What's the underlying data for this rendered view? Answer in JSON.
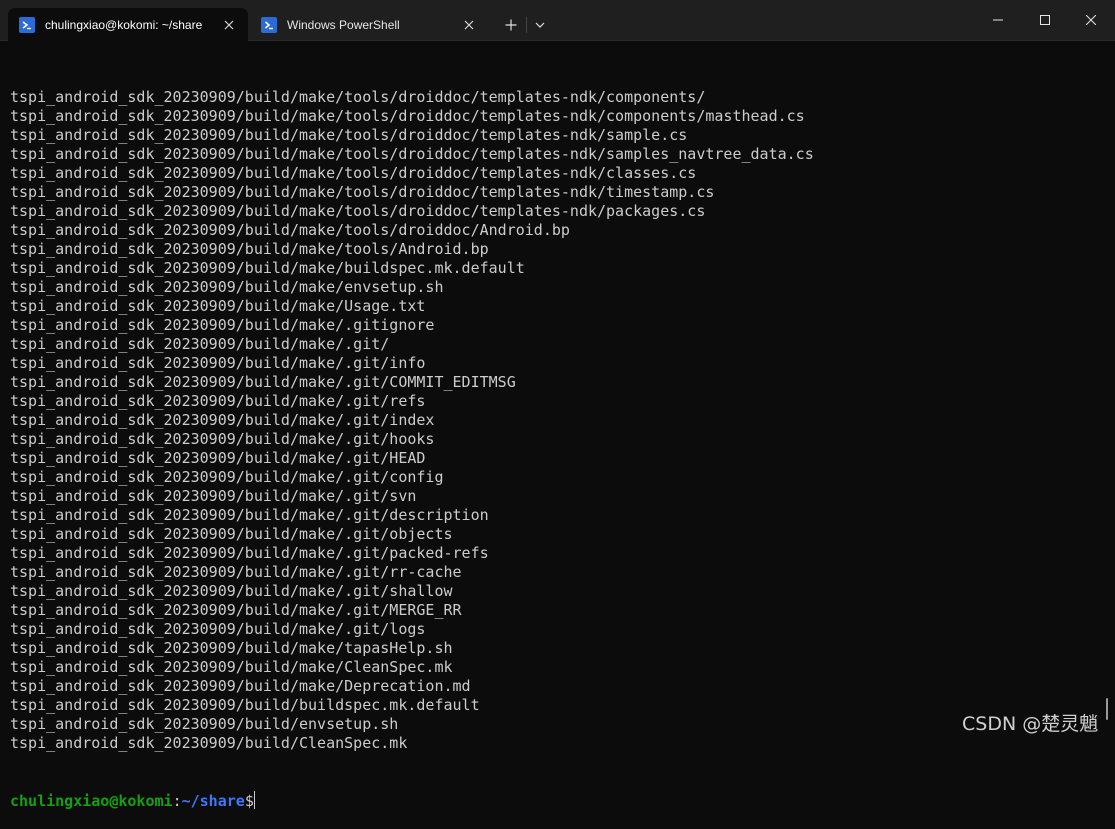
{
  "tabs": [
    {
      "title": "chulingxiao@kokomi: ~/share",
      "icon": "linux-terminal-icon",
      "active": true
    },
    {
      "title": "Windows PowerShell",
      "icon": "powershell-icon",
      "active": false
    }
  ],
  "toolbar": {
    "new_tab_icon": "plus-icon",
    "dropdown_icon": "chevron-down-icon"
  },
  "window_controls": [
    "minimize-icon",
    "maximize-icon",
    "close-icon"
  ],
  "colors": {
    "background": "#0c0c0c",
    "titlebar": "#1f1f1f",
    "text": "#cccccc",
    "prompt_user": "#13a10e",
    "prompt_path": "#3b78ff",
    "tab_icon": "#2b6bd6"
  },
  "terminal": {
    "lines": [
      "tspi_android_sdk_20230909/build/make/tools/droiddoc/templates-ndk/components/",
      "tspi_android_sdk_20230909/build/make/tools/droiddoc/templates-ndk/components/masthead.cs",
      "tspi_android_sdk_20230909/build/make/tools/droiddoc/templates-ndk/sample.cs",
      "tspi_android_sdk_20230909/build/make/tools/droiddoc/templates-ndk/samples_navtree_data.cs",
      "tspi_android_sdk_20230909/build/make/tools/droiddoc/templates-ndk/classes.cs",
      "tspi_android_sdk_20230909/build/make/tools/droiddoc/templates-ndk/timestamp.cs",
      "tspi_android_sdk_20230909/build/make/tools/droiddoc/templates-ndk/packages.cs",
      "tspi_android_sdk_20230909/build/make/tools/droiddoc/Android.bp",
      "tspi_android_sdk_20230909/build/make/tools/Android.bp",
      "tspi_android_sdk_20230909/build/make/buildspec.mk.default",
      "tspi_android_sdk_20230909/build/make/envsetup.sh",
      "tspi_android_sdk_20230909/build/make/Usage.txt",
      "tspi_android_sdk_20230909/build/make/.gitignore",
      "tspi_android_sdk_20230909/build/make/.git/",
      "tspi_android_sdk_20230909/build/make/.git/info",
      "tspi_android_sdk_20230909/build/make/.git/COMMIT_EDITMSG",
      "tspi_android_sdk_20230909/build/make/.git/refs",
      "tspi_android_sdk_20230909/build/make/.git/index",
      "tspi_android_sdk_20230909/build/make/.git/hooks",
      "tspi_android_sdk_20230909/build/make/.git/HEAD",
      "tspi_android_sdk_20230909/build/make/.git/config",
      "tspi_android_sdk_20230909/build/make/.git/svn",
      "tspi_android_sdk_20230909/build/make/.git/description",
      "tspi_android_sdk_20230909/build/make/.git/objects",
      "tspi_android_sdk_20230909/build/make/.git/packed-refs",
      "tspi_android_sdk_20230909/build/make/.git/rr-cache",
      "tspi_android_sdk_20230909/build/make/.git/shallow",
      "tspi_android_sdk_20230909/build/make/.git/MERGE_RR",
      "tspi_android_sdk_20230909/build/make/.git/logs",
      "tspi_android_sdk_20230909/build/make/tapasHelp.sh",
      "tspi_android_sdk_20230909/build/make/CleanSpec.mk",
      "tspi_android_sdk_20230909/build/make/Deprecation.md",
      "tspi_android_sdk_20230909/build/buildspec.mk.default",
      "tspi_android_sdk_20230909/build/envsetup.sh",
      "tspi_android_sdk_20230909/build/CleanSpec.mk"
    ],
    "prompt": {
      "user_host": "chulingxiao@kokomi",
      "colon": ":",
      "path": "~/share",
      "symbol": "$"
    }
  },
  "watermark": "CSDN @楚灵魈"
}
